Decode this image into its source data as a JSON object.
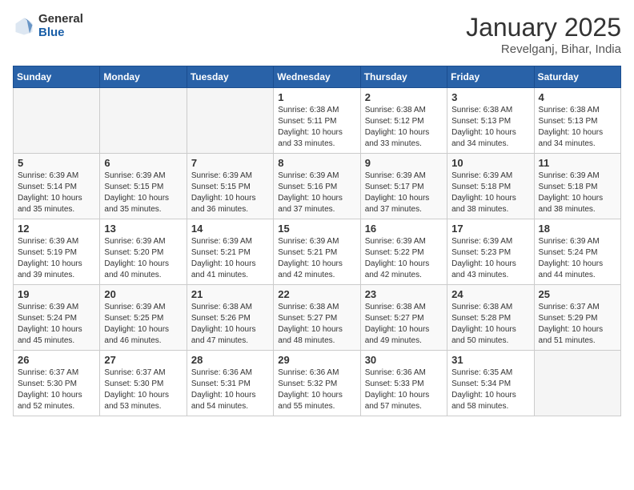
{
  "header": {
    "logo_general": "General",
    "logo_blue": "Blue",
    "month_title": "January 2025",
    "location": "Revelganj, Bihar, India"
  },
  "days_of_week": [
    "Sunday",
    "Monday",
    "Tuesday",
    "Wednesday",
    "Thursday",
    "Friday",
    "Saturday"
  ],
  "weeks": [
    [
      {
        "day": "",
        "info": ""
      },
      {
        "day": "",
        "info": ""
      },
      {
        "day": "",
        "info": ""
      },
      {
        "day": "1",
        "info": "Sunrise: 6:38 AM\nSunset: 5:11 PM\nDaylight: 10 hours\nand 33 minutes."
      },
      {
        "day": "2",
        "info": "Sunrise: 6:38 AM\nSunset: 5:12 PM\nDaylight: 10 hours\nand 33 minutes."
      },
      {
        "day": "3",
        "info": "Sunrise: 6:38 AM\nSunset: 5:13 PM\nDaylight: 10 hours\nand 34 minutes."
      },
      {
        "day": "4",
        "info": "Sunrise: 6:38 AM\nSunset: 5:13 PM\nDaylight: 10 hours\nand 34 minutes."
      }
    ],
    [
      {
        "day": "5",
        "info": "Sunrise: 6:39 AM\nSunset: 5:14 PM\nDaylight: 10 hours\nand 35 minutes."
      },
      {
        "day": "6",
        "info": "Sunrise: 6:39 AM\nSunset: 5:15 PM\nDaylight: 10 hours\nand 35 minutes."
      },
      {
        "day": "7",
        "info": "Sunrise: 6:39 AM\nSunset: 5:15 PM\nDaylight: 10 hours\nand 36 minutes."
      },
      {
        "day": "8",
        "info": "Sunrise: 6:39 AM\nSunset: 5:16 PM\nDaylight: 10 hours\nand 37 minutes."
      },
      {
        "day": "9",
        "info": "Sunrise: 6:39 AM\nSunset: 5:17 PM\nDaylight: 10 hours\nand 37 minutes."
      },
      {
        "day": "10",
        "info": "Sunrise: 6:39 AM\nSunset: 5:18 PM\nDaylight: 10 hours\nand 38 minutes."
      },
      {
        "day": "11",
        "info": "Sunrise: 6:39 AM\nSunset: 5:18 PM\nDaylight: 10 hours\nand 38 minutes."
      }
    ],
    [
      {
        "day": "12",
        "info": "Sunrise: 6:39 AM\nSunset: 5:19 PM\nDaylight: 10 hours\nand 39 minutes."
      },
      {
        "day": "13",
        "info": "Sunrise: 6:39 AM\nSunset: 5:20 PM\nDaylight: 10 hours\nand 40 minutes."
      },
      {
        "day": "14",
        "info": "Sunrise: 6:39 AM\nSunset: 5:21 PM\nDaylight: 10 hours\nand 41 minutes."
      },
      {
        "day": "15",
        "info": "Sunrise: 6:39 AM\nSunset: 5:21 PM\nDaylight: 10 hours\nand 42 minutes."
      },
      {
        "day": "16",
        "info": "Sunrise: 6:39 AM\nSunset: 5:22 PM\nDaylight: 10 hours\nand 42 minutes."
      },
      {
        "day": "17",
        "info": "Sunrise: 6:39 AM\nSunset: 5:23 PM\nDaylight: 10 hours\nand 43 minutes."
      },
      {
        "day": "18",
        "info": "Sunrise: 6:39 AM\nSunset: 5:24 PM\nDaylight: 10 hours\nand 44 minutes."
      }
    ],
    [
      {
        "day": "19",
        "info": "Sunrise: 6:39 AM\nSunset: 5:24 PM\nDaylight: 10 hours\nand 45 minutes."
      },
      {
        "day": "20",
        "info": "Sunrise: 6:39 AM\nSunset: 5:25 PM\nDaylight: 10 hours\nand 46 minutes."
      },
      {
        "day": "21",
        "info": "Sunrise: 6:38 AM\nSunset: 5:26 PM\nDaylight: 10 hours\nand 47 minutes."
      },
      {
        "day": "22",
        "info": "Sunrise: 6:38 AM\nSunset: 5:27 PM\nDaylight: 10 hours\nand 48 minutes."
      },
      {
        "day": "23",
        "info": "Sunrise: 6:38 AM\nSunset: 5:27 PM\nDaylight: 10 hours\nand 49 minutes."
      },
      {
        "day": "24",
        "info": "Sunrise: 6:38 AM\nSunset: 5:28 PM\nDaylight: 10 hours\nand 50 minutes."
      },
      {
        "day": "25",
        "info": "Sunrise: 6:37 AM\nSunset: 5:29 PM\nDaylight: 10 hours\nand 51 minutes."
      }
    ],
    [
      {
        "day": "26",
        "info": "Sunrise: 6:37 AM\nSunset: 5:30 PM\nDaylight: 10 hours\nand 52 minutes."
      },
      {
        "day": "27",
        "info": "Sunrise: 6:37 AM\nSunset: 5:30 PM\nDaylight: 10 hours\nand 53 minutes."
      },
      {
        "day": "28",
        "info": "Sunrise: 6:36 AM\nSunset: 5:31 PM\nDaylight: 10 hours\nand 54 minutes."
      },
      {
        "day": "29",
        "info": "Sunrise: 6:36 AM\nSunset: 5:32 PM\nDaylight: 10 hours\nand 55 minutes."
      },
      {
        "day": "30",
        "info": "Sunrise: 6:36 AM\nSunset: 5:33 PM\nDaylight: 10 hours\nand 57 minutes."
      },
      {
        "day": "31",
        "info": "Sunrise: 6:35 AM\nSunset: 5:34 PM\nDaylight: 10 hours\nand 58 minutes."
      },
      {
        "day": "",
        "info": ""
      }
    ]
  ]
}
